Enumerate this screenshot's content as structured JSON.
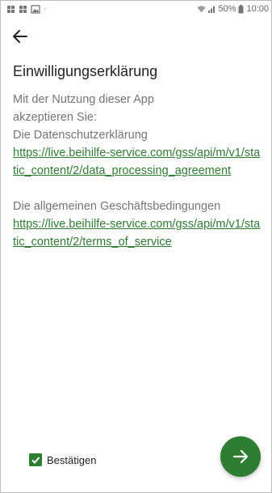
{
  "status_bar": {
    "left_icons": [
      "app-icon",
      "app-icon",
      "image-icon"
    ],
    "dot": "·",
    "battery": "50%",
    "time": "10:00"
  },
  "page": {
    "title": "Einwilligungserklärung",
    "intro_line1": "Mit der Nutzung dieser App",
    "intro_line2": "akzeptieren Sie:",
    "privacy_label": "Die Datenschutzerklärung",
    "privacy_link": "https://live.beihilfe-service.com/gss/api/m/v1/static_content/2/data_processing_agreement",
    "terms_label": "Die allgemeinen Geschäftsbedingungen",
    "terms_link": "https://live.beihilfe-service.com/gss/api/m/v1/static_content/2/terms_of_service"
  },
  "footer": {
    "checkbox_label": "Bestätigen",
    "checkbox_checked": true
  },
  "colors": {
    "accent": "#2e7d32",
    "text_primary": "#222222",
    "text_secondary": "#757575"
  }
}
